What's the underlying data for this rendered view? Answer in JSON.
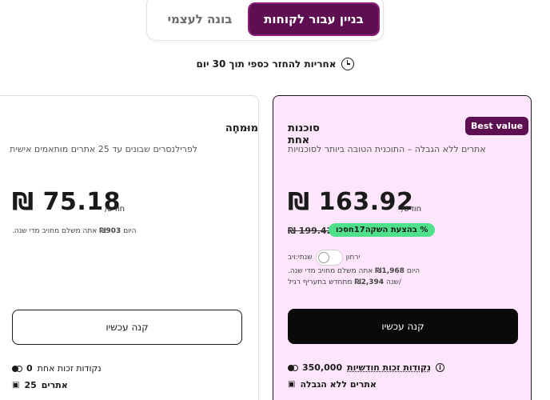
{
  "toggle": {
    "active_label": "בניין עבור לקוחות",
    "inactive_label": "בונה לעצמי"
  },
  "guarantee": {
    "text": "אחריות להחזר כספי תוך 30 יום"
  },
  "plans": {
    "pro": {
      "title": "מוּמחֶה",
      "description": "לפרילנסרים שבונים עד 25 אתרים מותאמים אישית",
      "price": "₪ 75.18",
      "per": "/חודש",
      "billing_prefix": "היום",
      "billing_amount": "₪903",
      "billing_suffix": "אתה משלם מחויב מדי שנה.",
      "cta": "קנה עכשיו",
      "features": [
        {
          "value": "0",
          "label": "נקודות זכות אחת"
        },
        {
          "value": "25",
          "label": "אתרים"
        }
      ]
    },
    "agency": {
      "badge": "Best value",
      "title": "סוכנות אחת",
      "description": "אתרים ללא הגבלה – התוכנית הטובה ביותר לסוכנויות",
      "price": "₪ 163.92",
      "per": "/חודש",
      "old_price": "₪ 199.42",
      "save": "% בהצעת השקה17חסכו",
      "toggle_monthly": "ירחון",
      "toggle_yearly": "שנתי:ויב",
      "billing1_prefix": "היום",
      "billing1_amount": "₪1,968",
      "billing1_suffix": "אתה משלם מחויב מדי שנה.",
      "billing2_prefix": "/שנה",
      "billing2_amount": "₪2,394",
      "billing2_suffix": "מתחדש בתעריף רגיל",
      "cta": "קנה עכשיו",
      "features": [
        {
          "value": "350,000",
          "label": "נקודות זכות חודשיות"
        },
        {
          "value": "",
          "label": "אתרים ללא הגבלה"
        }
      ]
    }
  }
}
